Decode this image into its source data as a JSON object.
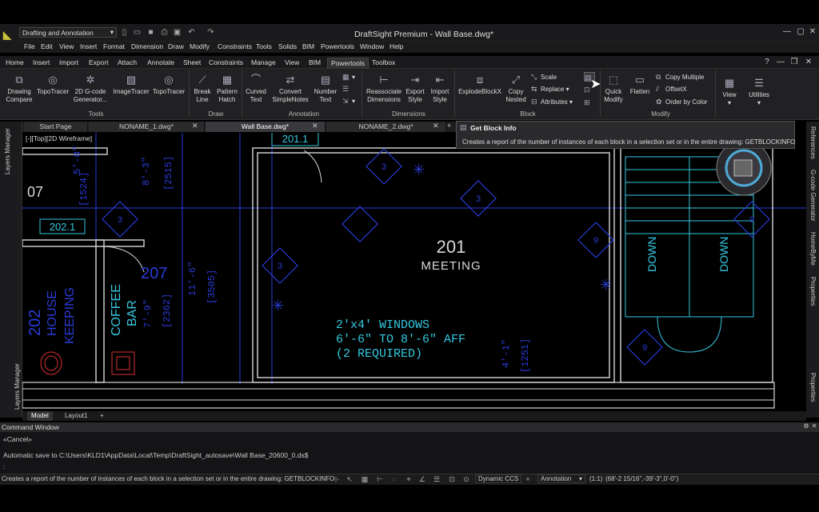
{
  "app": {
    "title": "DraftSight Premium - Wall Base.dwg*",
    "workspace": "Drafting and Annotation"
  },
  "menu": [
    "File",
    "Edit",
    "View",
    "Insert",
    "Format",
    "Dimension",
    "Draw",
    "Modify",
    "Constraints",
    "Tools",
    "Solids",
    "BIM",
    "Powertools",
    "Window",
    "Help"
  ],
  "ribbon_tabs": [
    "Home",
    "Insert",
    "Import",
    "Export",
    "Attach",
    "Annotate",
    "Sheet",
    "Constraints",
    "Manage",
    "View",
    "BIM",
    "Powertools",
    "Toolbox"
  ],
  "ribbon": {
    "tools": {
      "drawing_compare": [
        "Drawing",
        "Compare"
      ],
      "topotracer": "TopoTracer",
      "gcode": [
        "2D G-code",
        "Generator..."
      ],
      "imagetracer": "ImageTracer",
      "topotracer2": "TopoTracer",
      "label": "Tools"
    },
    "draw": {
      "break_line": [
        "Break",
        "Line"
      ],
      "pattern_hatch": [
        "Pattern",
        "Hatch"
      ],
      "label": "Draw"
    },
    "annotation": {
      "curved_text": [
        "Curved",
        "Text"
      ],
      "convert_simplenotes": [
        "Convert",
        "SimpleNotes"
      ],
      "number_text": [
        "Number",
        "Text"
      ],
      "label": "Annotation"
    },
    "dimensions": {
      "reassociate": [
        "Reassociate",
        "Dimensions"
      ],
      "export_style": [
        "Export",
        "Style"
      ],
      "import_style": [
        "Import",
        "Style"
      ],
      "label": "Dimensions"
    },
    "block": {
      "explode": "ExplodeBlockX",
      "copy_nested": [
        "Copy",
        "Nested"
      ],
      "scale": "Scale",
      "replace": "Replace",
      "attributes": "Attributes",
      "label": "Block"
    },
    "modify": {
      "quick_modify": [
        "Quick",
        "Modify"
      ],
      "flatten": "Flatten",
      "copy_multiple": "Copy Multiple",
      "offsetx": "OffsetX",
      "order_by_color": "Order by Color",
      "label": "Modify"
    },
    "view": "View",
    "utilities": "Utilities"
  },
  "doc_tabs": [
    "Start Page",
    "NONAME_1.dwg*",
    "Wall Base.dwg*",
    "NONAME_2.dwg*"
  ],
  "tooltip": {
    "title": "Get Block Info",
    "description": "Creates a report of the number of instances of each block in a selection set or in the entire drawing: GETBLOCKINFO"
  },
  "viewport_label": "[-][Top][2D Wireframe]",
  "side_panels": {
    "left": [
      "Layers Manager",
      "Layers Manager"
    ],
    "right": [
      "References",
      "G-code Generator",
      "HomeByMe",
      "Properties",
      "Properties"
    ]
  },
  "drawing": {
    "room_201": "201",
    "room_201_name": "MEETING",
    "room_202": "202",
    "room_202_name": [
      "HOUSE",
      "KEEPING"
    ],
    "room_207": "207",
    "coffee": [
      "COFFEE",
      "BAR"
    ],
    "tag_201_1": "201.1",
    "tag_202_1": "202.1",
    "label_07": "07",
    "windows_note": [
      "2'x4' WINDOWS",
      "6'-6\" TO 8'-6\" AFF",
      "(2 REQUIRED)"
    ],
    "down": "DOWN",
    "dims": [
      "[2515]",
      "[1524]",
      "8'-3\"",
      "5'-0\"",
      "11'-6\"",
      "[3505]",
      "[2362]",
      "7'-9\"",
      "[1251]",
      "4'-1\"",
      "3'-3\""
    ],
    "tag_3": "3",
    "tag_9": "9"
  },
  "model_tabs": [
    "Model",
    "Layout1"
  ],
  "command": {
    "title": "Command Window",
    "lines": [
      "«Cancel»",
      "Automatic save to C:\\Users\\KLD1\\AppData\\Local\\Temp\\DraftSight_autosave\\Wall Base_20600_0.ds$",
      ":"
    ]
  },
  "status": {
    "text": "Creates a report of the number of instances of each block in a selection set or in the entire drawing: GETBLOCKINFO",
    "ccs": "Dynamic CCS",
    "annotation": "Annotation",
    "scale": "(1:1)",
    "coords": "(68'-2 15/16\",-39'-3\",0'-0\")"
  },
  "colors": {
    "cad_blue": "#2a3bd6",
    "cad_cyan": "#35c8e0",
    "wall_white": "#d8d8d8",
    "red": "#d83030"
  }
}
